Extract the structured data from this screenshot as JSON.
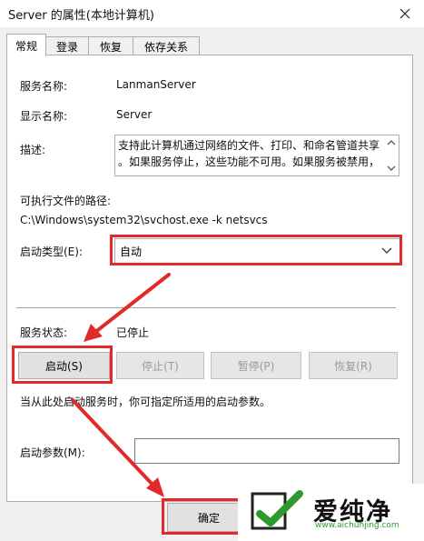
{
  "window": {
    "title": "Server 的属性(本地计算机)"
  },
  "tabs": [
    {
      "label": "常规",
      "active": true
    },
    {
      "label": "登录",
      "active": false
    },
    {
      "label": "恢复",
      "active": false
    },
    {
      "label": "依存关系",
      "active": false
    }
  ],
  "general": {
    "service_name_label": "服务名称:",
    "service_name": "LanmanServer",
    "display_name_label": "显示名称:",
    "display_name": "Server",
    "description_label": "描述:",
    "description_line1": "支持此计算机通过网络的文件、打印、和命名管道共享",
    "description_line2": "。如果服务停止，这些功能不可用。如果服务被禁用，",
    "exe_path_label": "可执行文件的路径:",
    "exe_path": "C:\\Windows\\system32\\svchost.exe -k netsvcs",
    "startup_type_label": "启动类型(E):",
    "startup_type_value": "自动",
    "status_label": "服务状态:",
    "status_value": "已停止",
    "buttons": {
      "start": "启动(S)",
      "stop": "停止(T)",
      "pause": "暂停(P)",
      "resume": "恢复(R)"
    },
    "hint": "当从此处启动服务时，你可指定所适用的启动参数。",
    "start_params_label": "启动参数(M):",
    "start_params_value": ""
  },
  "footer": {
    "ok_label": "确定"
  },
  "watermark": {
    "brand": "爱纯净",
    "url": "www.aichunjing.com",
    "accent": "#2d9a2d"
  },
  "annotation_color": "#e12a2a"
}
